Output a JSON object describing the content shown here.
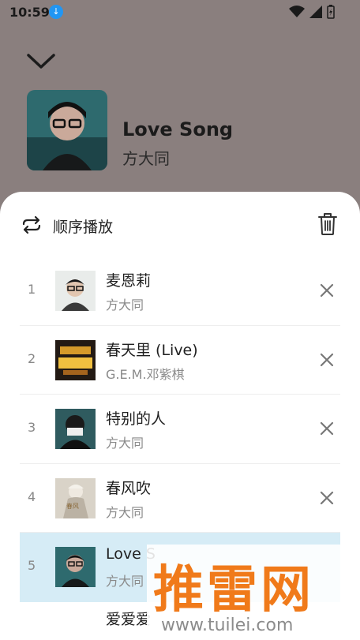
{
  "status_bar": {
    "time": "10:59",
    "download_badge": "↓"
  },
  "now_playing": {
    "title": "Love Song",
    "artist": "方大同"
  },
  "sheet": {
    "mode_label": "顺序播放",
    "items": [
      {
        "num": "1",
        "title": "麦恩莉",
        "artist": "方大同"
      },
      {
        "num": "2",
        "title": "春天里 (Live)",
        "artist": "G.E.M.邓紫棋"
      },
      {
        "num": "3",
        "title": "特别的人",
        "artist": "方大同"
      },
      {
        "num": "4",
        "title": "春风吹",
        "artist": "方大同"
      },
      {
        "num": "5",
        "title": "Love S",
        "artist": "方大同"
      }
    ],
    "partial_title": "爱爱爱"
  },
  "watermark": {
    "brand": "推雷网",
    "url": "www.tuilei.com"
  },
  "colors": {
    "background": "#8a7f7e",
    "sheet": "#ffffff",
    "active_row": "#d6ecf6",
    "watermark": "#f07a1a"
  }
}
